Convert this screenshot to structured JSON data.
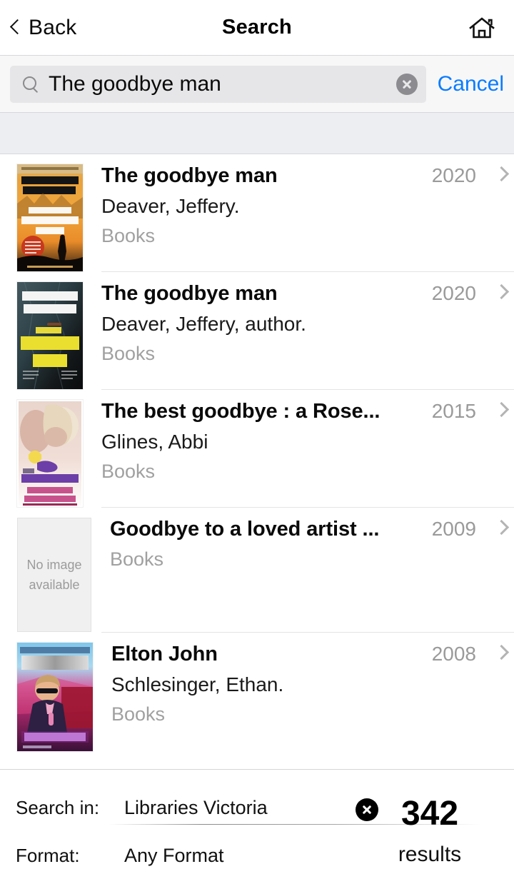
{
  "header": {
    "back_label": "Back",
    "title": "Search",
    "home_icon": "home-icon",
    "back_icon": "chevron-left-icon"
  },
  "search": {
    "icon": "search-icon",
    "value": "The goodbye man",
    "placeholder": "Search",
    "clear_icon": "clear-circle-icon",
    "cancel_label": "Cancel",
    "accent_color": "#0a7cff"
  },
  "results": [
    {
      "title": "The goodbye man",
      "author": "Deaver, Jeffery.",
      "format": "Books",
      "year": "2020",
      "cover": "jeffery-deaver-goodbye-man-orange",
      "has_cover": true
    },
    {
      "title": "The goodbye man",
      "author": "Deaver, Jeffery, author.",
      "format": "Books",
      "year": "2020",
      "cover": "jeffery-deaver-goodbye-man-dark",
      "has_cover": true
    },
    {
      "title": "The best goodbye : a Rose...",
      "author": "Glines, Abbi",
      "format": "Books",
      "year": "2015",
      "cover": "abbi-glines-best-goodbye",
      "has_cover": true
    },
    {
      "title": "Goodbye to a loved artist ...",
      "author": "",
      "format": "Books",
      "year": "2009",
      "cover": "no-image-placeholder",
      "has_cover": false,
      "no_image_line1": "No image",
      "no_image_line2": "available"
    },
    {
      "title": "Elton John",
      "author": "Schlesinger, Ethan.",
      "format": "Books",
      "year": "2008",
      "cover": "elton-john-pop-rock",
      "has_cover": true
    }
  ],
  "footer": {
    "search_in_label": "Search in:",
    "search_in_value": "Libraries Victoria",
    "format_label": "Format:",
    "format_value": "Any Format",
    "clear_icon": "clear-filters-icon",
    "result_count": "342",
    "result_word": "results"
  }
}
